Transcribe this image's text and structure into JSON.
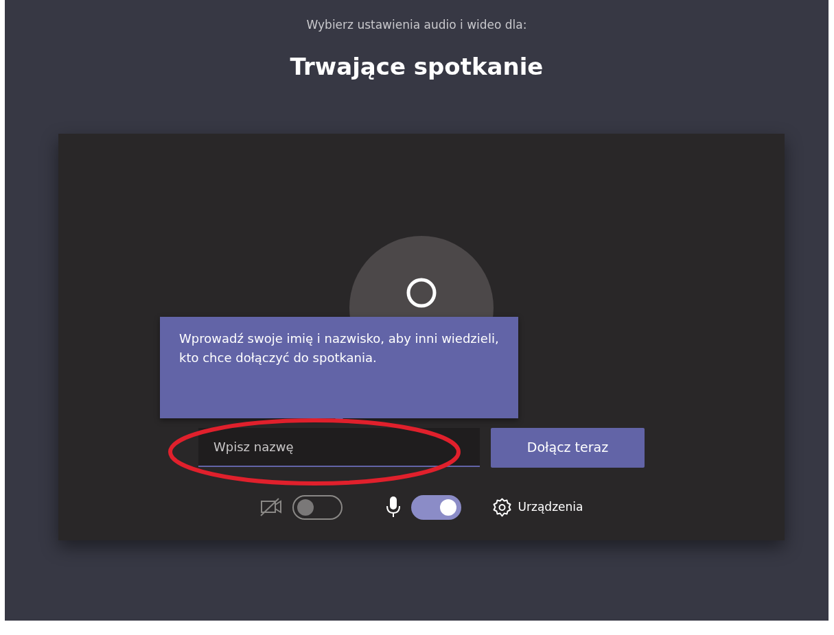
{
  "header": {
    "subtitle": "Wybierz ustawienia audio i wideo dla:",
    "title": "Trwające spotkanie"
  },
  "tooltip": {
    "text": "Wprowadź swoje imię i nazwisko, aby inni wiedzieli, kto chce dołączyć do spotkania."
  },
  "name_field": {
    "placeholder": "Wpisz nazwę"
  },
  "join_button": {
    "label": "Dołącz teraz"
  },
  "controls": [
    {
      "kind": "camera",
      "on": false
    },
    {
      "kind": "microphone",
      "on": true
    }
  ],
  "devices_button": {
    "label": "Urządzenia"
  },
  "annotation": {
    "kind": "ellipse",
    "color": "#e0202c"
  }
}
